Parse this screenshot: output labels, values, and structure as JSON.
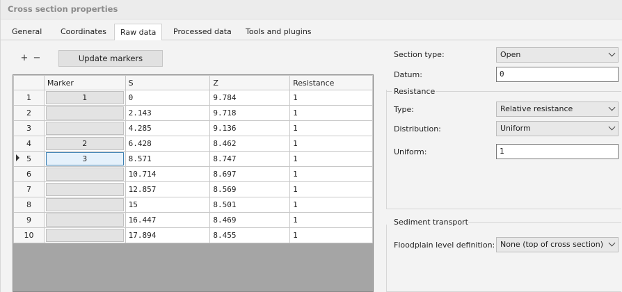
{
  "window": {
    "title": "Cross section properties"
  },
  "tabs": [
    {
      "label": "General"
    },
    {
      "label": "Coordinates"
    },
    {
      "label": "Raw data"
    },
    {
      "label": "Processed data"
    },
    {
      "label": "Tools and plugins"
    }
  ],
  "toolbar": {
    "add_label": "+",
    "remove_label": "−",
    "update_markers_label": "Update markers"
  },
  "table": {
    "columns": [
      "Marker",
      "S",
      "Z",
      "Resistance"
    ],
    "selected_row": 5,
    "rows": [
      {
        "num": "1",
        "marker": "1",
        "s": "0",
        "z": "9.784",
        "resistance": "1"
      },
      {
        "num": "2",
        "marker": "",
        "s": "2.143",
        "z": "9.718",
        "resistance": "1"
      },
      {
        "num": "3",
        "marker": "",
        "s": "4.285",
        "z": "9.136",
        "resistance": "1"
      },
      {
        "num": "4",
        "marker": "2",
        "s": "6.428",
        "z": "8.462",
        "resistance": "1"
      },
      {
        "num": "5",
        "marker": "3",
        "s": "8.571",
        "z": "8.747",
        "resistance": "1"
      },
      {
        "num": "6",
        "marker": "",
        "s": "10.714",
        "z": "8.697",
        "resistance": "1"
      },
      {
        "num": "7",
        "marker": "",
        "s": "12.857",
        "z": "8.569",
        "resistance": "1"
      },
      {
        "num": "8",
        "marker": "",
        "s": "15",
        "z": "8.501",
        "resistance": "1"
      },
      {
        "num": "9",
        "marker": "",
        "s": "16.447",
        "z": "8.469",
        "resistance": "1"
      },
      {
        "num": "10",
        "marker": "",
        "s": "17.894",
        "z": "8.455",
        "resistance": "1"
      }
    ]
  },
  "properties": {
    "section_type": {
      "label": "Section type:",
      "value": "Open"
    },
    "datum": {
      "label": "Datum:",
      "value": "0"
    },
    "resistance_group": {
      "title": "Resistance",
      "type": {
        "label": "Type:",
        "value": "Relative resistance"
      },
      "distribution": {
        "label": "Distribution:",
        "value": "Uniform"
      },
      "uniform": {
        "label": "Uniform:",
        "value": "1"
      }
    },
    "sediment_group": {
      "title": "Sediment transport",
      "floodplain": {
        "label": "Floodplain level definition:",
        "value": "None (top of cross section)"
      }
    }
  }
}
